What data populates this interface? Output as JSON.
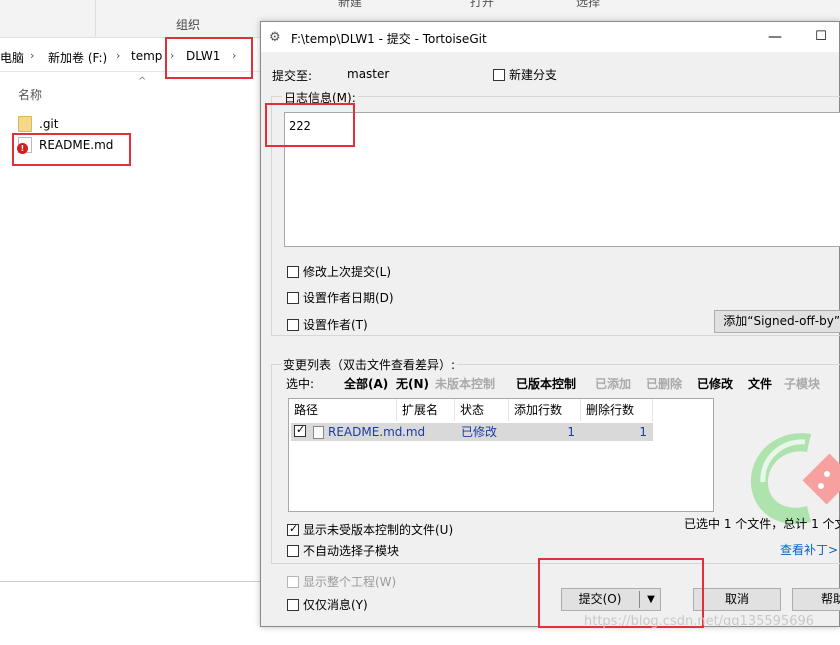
{
  "explorer": {
    "ribbon_group": "组织",
    "ribbon_cut_1": "新建",
    "ribbon_cut_2": "打开",
    "ribbon_cut_3": "选择",
    "breadcrumb": [
      "电脑",
      "新加卷 (F:)",
      "temp",
      "DLW1"
    ],
    "column_name": "名称",
    "files": [
      {
        "name": ".git",
        "icon": "folder-icon"
      },
      {
        "name": "README.md",
        "icon": "error-overlay-icon"
      }
    ]
  },
  "dialog": {
    "title": "F:\\temp\\DLW1 - 提交 - TortoiseGit",
    "commit_to_label": "提交至:",
    "branch": "master",
    "new_branch_label": "新建分支",
    "log_message_label": "日志信息(M):",
    "message_text": "222",
    "amend_label": "修改上次提交(L)",
    "set_author_date_label": "设置作者日期(D)",
    "set_author_label": "设置作者(T)",
    "signed_off_button": "添加“Signed-off-by”(",
    "changes_label": "变更列表（双击文件查看差异）:",
    "select_label": "选中:",
    "filters": {
      "all": "全部(A)",
      "none": "无(N)",
      "unversioned": "未版本控制",
      "versioned": "已版本控制",
      "added": "已添加",
      "deleted": "已删除",
      "modified": "已修改",
      "files": "文件",
      "submodules": "子模块"
    },
    "columns": [
      "路径",
      "扩展名",
      "状态",
      "添加行数",
      "删除行数"
    ],
    "rows": [
      {
        "checked": true,
        "path": "README.md",
        "ext": ".md",
        "status": "已修改",
        "added": "1",
        "deleted": "1"
      }
    ],
    "show_unversioned_label": "显示未受版本控制的文件(U)",
    "no_auto_submodule_label": "不自动选择子模块",
    "selection_summary": "已选中 1 个文件，总计 1 个文",
    "view_patch_link": "查看补丁>",
    "show_whole_project_label": "显示整个工程(W)",
    "message_only_label": "仅仅消息(Y)",
    "commit_button": "提交(O)",
    "cancel_button": "取消",
    "help_button": "帮助"
  },
  "watermark": "https://blog.csdn.net/qq135595696",
  "colors": {
    "highlight": "#e2303a",
    "link": "#0066cc",
    "item_text": "#1a3da3"
  }
}
